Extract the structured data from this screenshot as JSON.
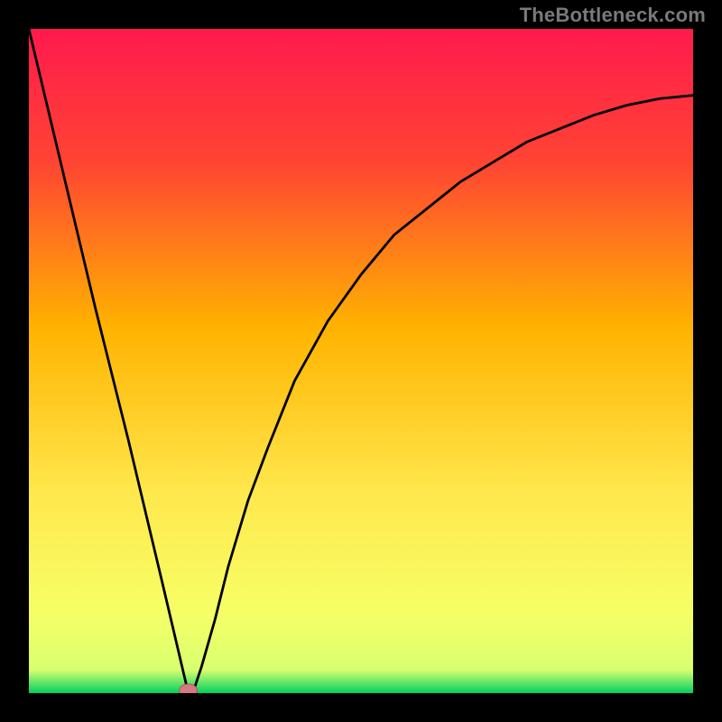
{
  "watermark": "TheBottleneck.com",
  "colors": {
    "frame": "#000000",
    "gradient_top": "#ff1a4d",
    "gradient_mid1": "#ff5a2e",
    "gradient_mid2": "#ffb300",
    "gradient_mid3": "#ffe84d",
    "gradient_mid4": "#f6ff66",
    "gradient_bottom": "#00d060",
    "curve": "#000000",
    "marker_fill": "#d47a80",
    "marker_stroke": "#a85a60"
  },
  "chart_data": {
    "type": "line",
    "title": "",
    "xlabel": "",
    "ylabel": "",
    "xlim": [
      0,
      100
    ],
    "ylim": [
      0,
      100
    ],
    "series": [
      {
        "name": "bottleneck-curve",
        "x": [
          0,
          5,
          10,
          15,
          20,
          24,
          25,
          26,
          28,
          30,
          33,
          36,
          40,
          45,
          50,
          55,
          60,
          65,
          70,
          75,
          80,
          85,
          90,
          95,
          100
        ],
        "y": [
          100,
          79,
          58,
          38,
          17,
          0,
          1,
          4,
          11,
          19,
          29,
          37,
          47,
          56,
          63,
          69,
          73,
          77,
          80,
          83,
          85,
          87,
          88.5,
          89.5,
          90
        ]
      }
    ],
    "annotations": [
      {
        "name": "minimum-marker",
        "x": 24,
        "y": 0
      }
    ],
    "background_gradient_stops": [
      {
        "pos": 0.0,
        "color": "#ff1a4d"
      },
      {
        "pos": 0.2,
        "color": "#ff4433"
      },
      {
        "pos": 0.45,
        "color": "#ffb300"
      },
      {
        "pos": 0.7,
        "color": "#ffe84d"
      },
      {
        "pos": 0.88,
        "color": "#f6ff66"
      },
      {
        "pos": 0.965,
        "color": "#d8ff70"
      },
      {
        "pos": 1.0,
        "color": "#00d060"
      }
    ],
    "legend": false,
    "grid": false
  }
}
